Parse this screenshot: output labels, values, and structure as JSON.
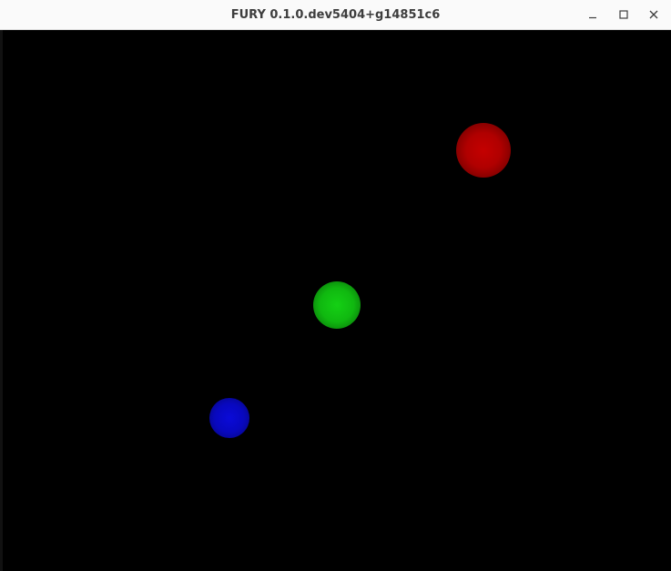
{
  "window": {
    "title": "FURY 0.1.0.dev5404+g14851c6",
    "controls": {
      "minimize_icon": "minimize-icon",
      "maximize_icon": "maximize-icon",
      "close_icon": "close-icon"
    }
  },
  "scene": {
    "background_color": "#000000",
    "spheres": [
      {
        "color": "#c40000",
        "label": "red"
      },
      {
        "color": "#14d014",
        "label": "green"
      },
      {
        "color": "#0a0ad8",
        "label": "blue"
      }
    ]
  }
}
